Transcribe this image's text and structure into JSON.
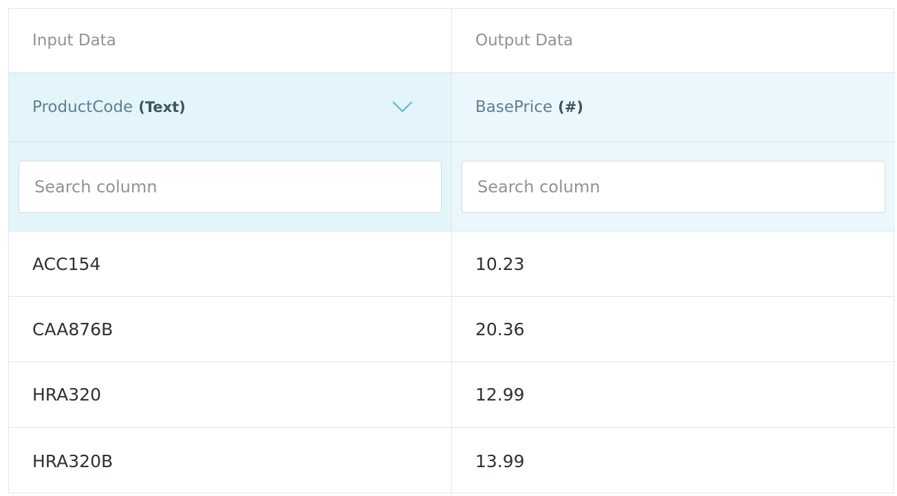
{
  "columns": {
    "input": {
      "header": "Input Data",
      "field_name": "ProductCode",
      "field_type": "(Text)",
      "search_placeholder": "Search column"
    },
    "output": {
      "header": "Output Data",
      "field_name": "BasePrice",
      "field_type": "(#)",
      "search_placeholder": "Search column"
    }
  },
  "rows": [
    {
      "input": "ACC154",
      "output": "10.23"
    },
    {
      "input": "CAA876B",
      "output": "20.36"
    },
    {
      "input": "HRA320",
      "output": "12.99"
    },
    {
      "input": "HRA320B",
      "output": "13.99"
    }
  ],
  "icons": {
    "dropdown": "chevron-down-icon"
  },
  "colors": {
    "header_band": "#e4f4fb",
    "chevron": "#5db8d6"
  }
}
